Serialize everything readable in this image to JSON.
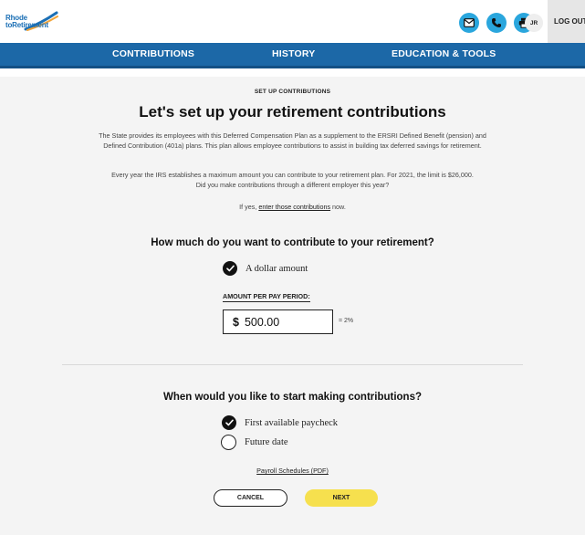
{
  "brand": {
    "logo_line1": "Rhode",
    "logo_line2": "toRetirement"
  },
  "header": {
    "icons": [
      "mail-icon",
      "phone-icon",
      "print-icon"
    ],
    "user_initials": "JR",
    "logout_label": "LOG OUT"
  },
  "nav": {
    "tabs": [
      {
        "label": "CONTRIBUTIONS"
      },
      {
        "label": "HISTORY"
      },
      {
        "label": "EDUCATION & TOOLS"
      }
    ]
  },
  "main": {
    "eyebrow": "SET UP CONTRIBUTIONS",
    "title": "Let's set up your retirement contributions",
    "intro_line1": "The State provides its employees with this Deferred Compensation Plan as a supplement to the ERSRI Defined Benefit (pension) and",
    "intro_line2": "Defined Contribution (401a) plans. This plan allows employee contributions to assist in building tax deferred savings for retirement.",
    "irs_line1": "Every year the IRS establishes a maximum amount you can contribute to your retirement plan. For 2021, the limit is $26,000.",
    "irs_line2": "Did you make contributions through a different employer this year?",
    "if_yes_prefix": "If yes, ",
    "if_yes_link": "enter those contributions",
    "if_yes_suffix": " now.",
    "contribute_question": "How much do you want to contribute to your retirement?",
    "dollar_option": "A dollar amount",
    "amount_label": "AMOUNT PER PAY PERIOD:",
    "currency_symbol": "$",
    "amount_value": "500.00",
    "percent_equiv": "= 2%",
    "start_question": "When would you like to start making contributions?",
    "start_options": [
      {
        "label": "First available paycheck",
        "selected": true
      },
      {
        "label": "Future date",
        "selected": false
      }
    ],
    "payroll_link": "Payroll Schedules (PDF)",
    "cancel_label": "CANCEL",
    "next_label": "NEXT"
  },
  "colors": {
    "nav_blue": "#1c68a7",
    "icon_blue": "#2aa6dd",
    "next_yellow": "#f6e04e"
  }
}
